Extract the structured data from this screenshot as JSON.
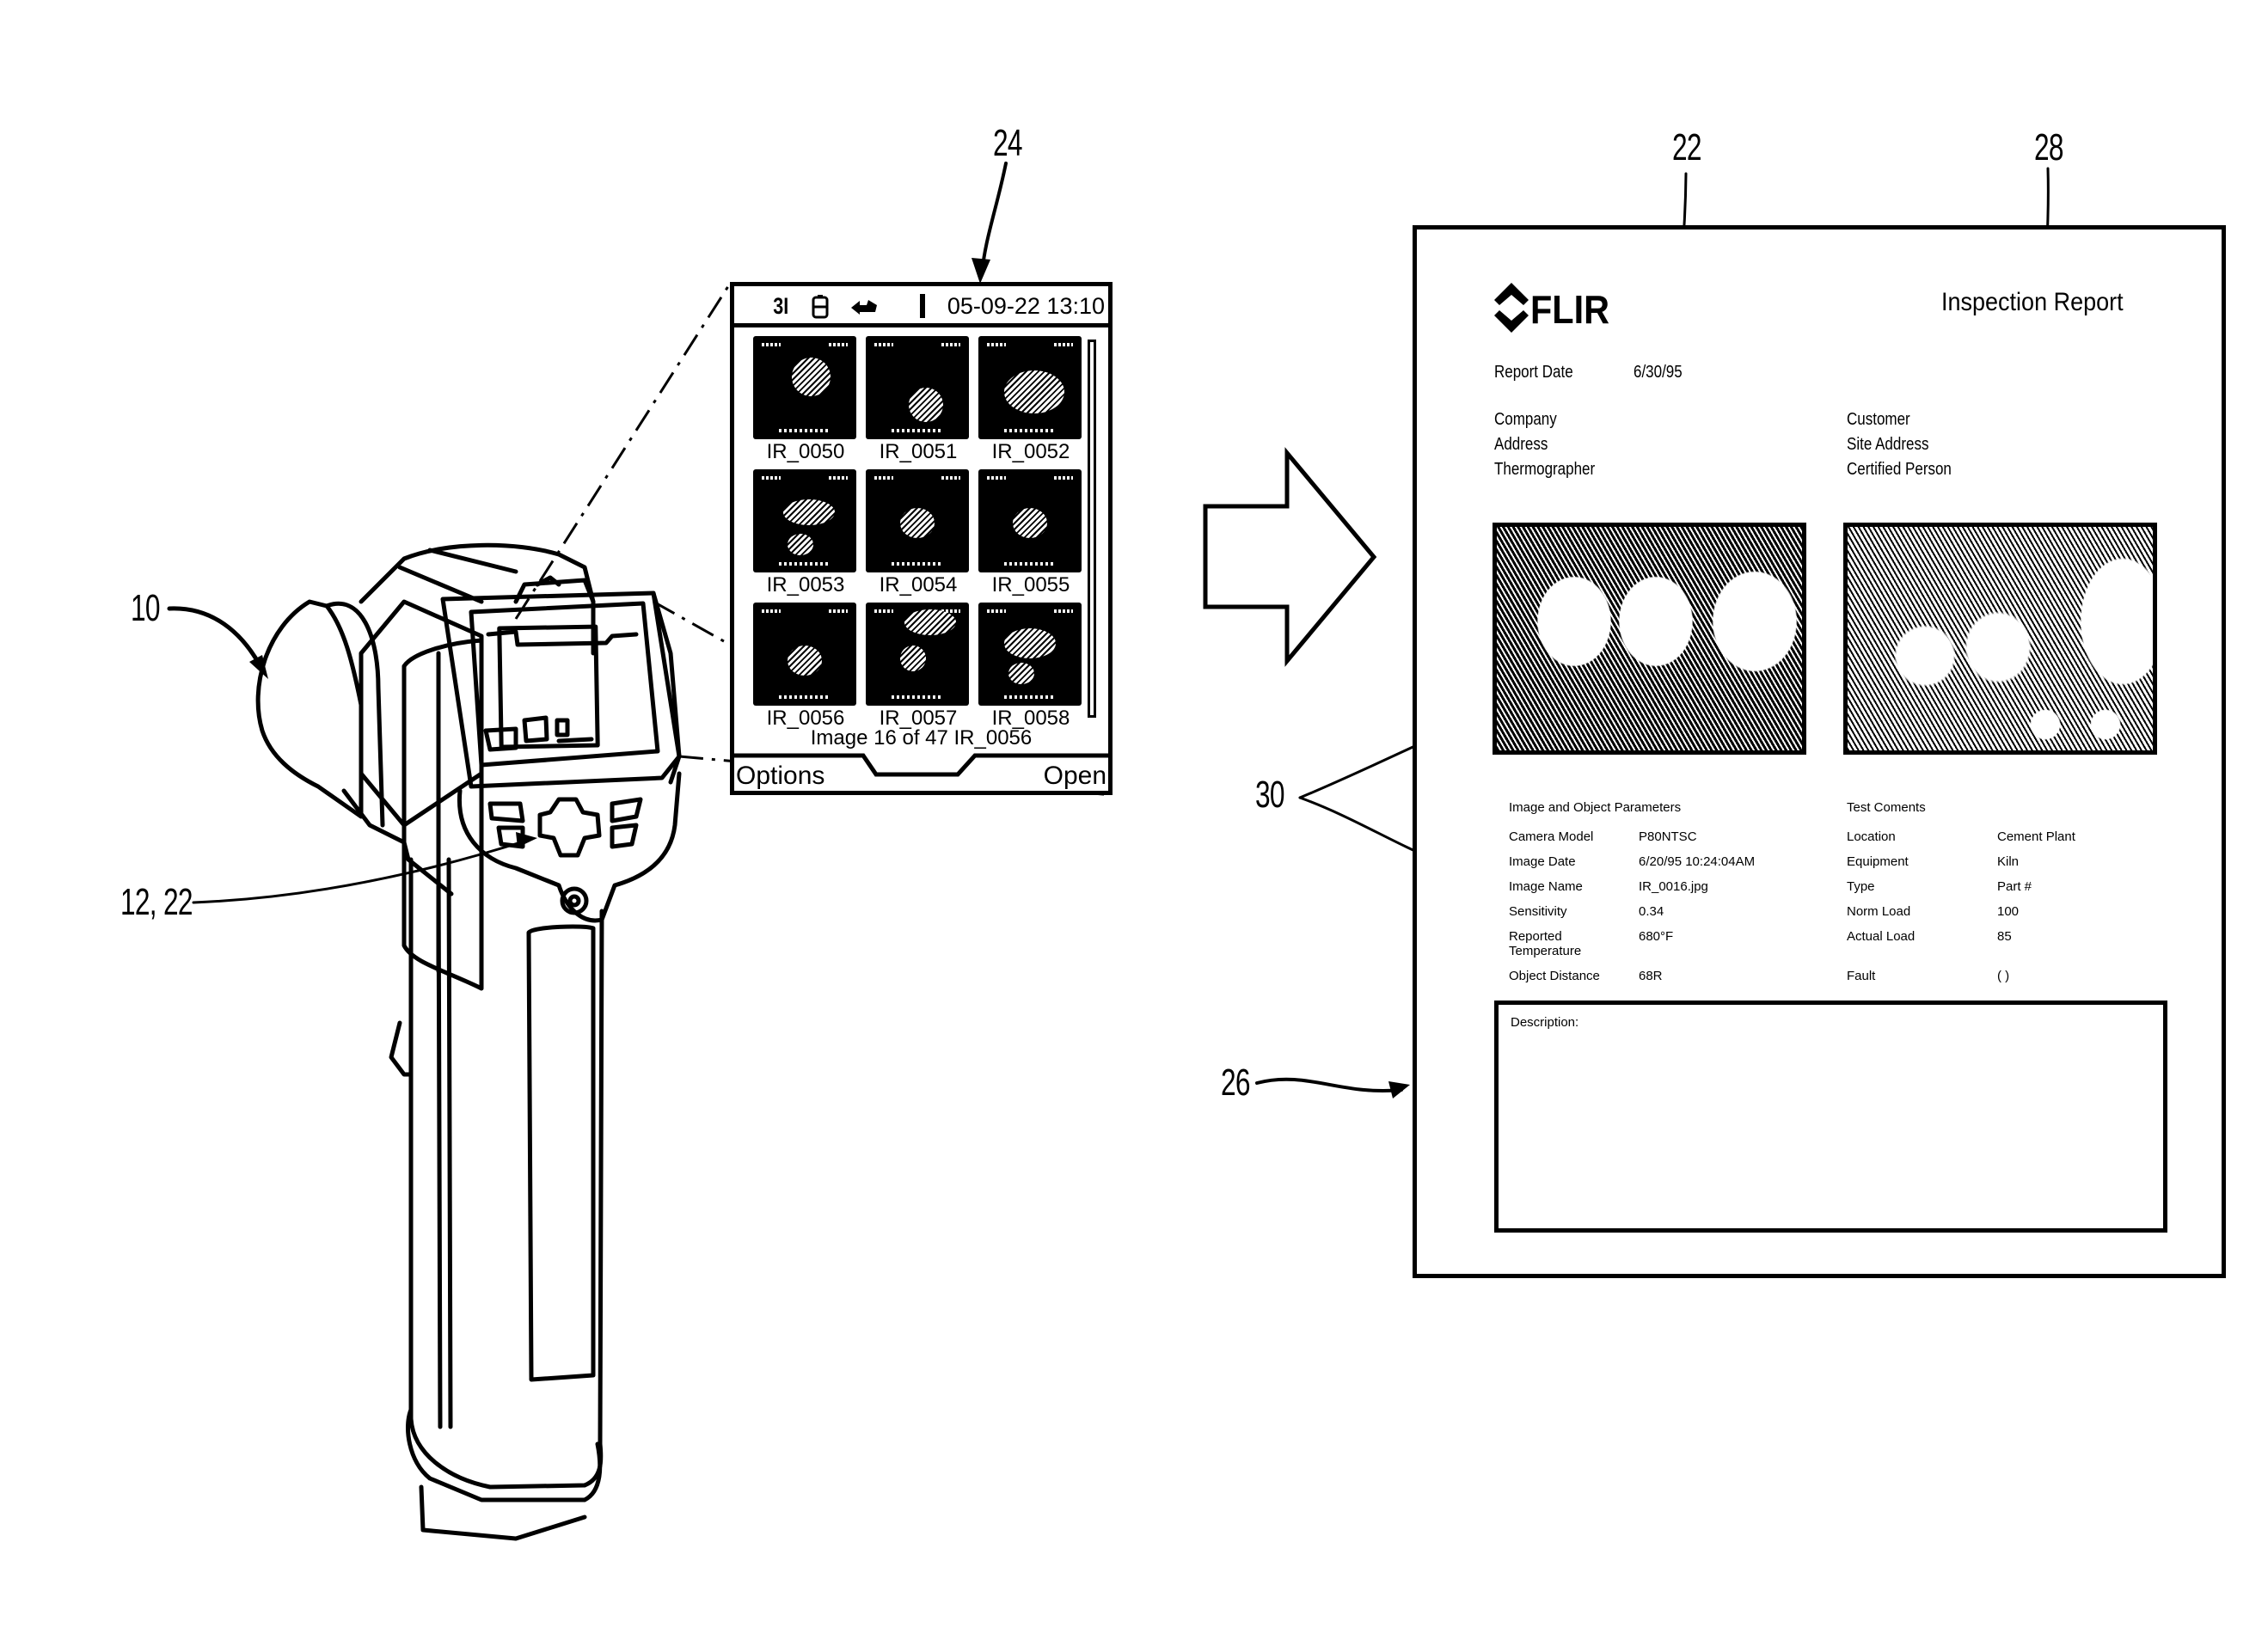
{
  "figure": {
    "reference_numerals": {
      "camera": "10",
      "camera_display": "12, 22",
      "screen_view": "24",
      "report": "26",
      "report_image_1": "22",
      "report_image_2": "28",
      "parameters": "30"
    }
  },
  "camera_screen": {
    "status_bar": {
      "icons": [
        {
          "name": "signal-icon",
          "glyph": "3I"
        },
        {
          "name": "battery-icon",
          "glyph": "battery"
        },
        {
          "name": "transfer-icon",
          "glyph": "arrow"
        },
        {
          "name": "divider-icon",
          "glyph": "I"
        }
      ],
      "datetime": "05-09-22 13:10"
    },
    "thumbnails": [
      {
        "label": "IR_0050"
      },
      {
        "label": "IR_0051"
      },
      {
        "label": "IR_0052"
      },
      {
        "label": "IR_0053"
      },
      {
        "label": "IR_0054"
      },
      {
        "label": "IR_0055"
      },
      {
        "label": "IR_0056"
      },
      {
        "label": "IR_0057"
      },
      {
        "label": "IR_0058"
      }
    ],
    "caption": "Image 16 of 47 IR_0056",
    "softkeys": {
      "left": "Options",
      "right": "Open"
    }
  },
  "report": {
    "logo": "FLIR",
    "title": "Inspection Report",
    "report_date_label": "Report Date",
    "report_date_value": "6/30/95",
    "left_fields": [
      "Company",
      "Address",
      "Thermographer"
    ],
    "right_fields": [
      "Customer",
      "Site Address",
      "Certified Person"
    ],
    "params_heading": "Image and Object Parameters",
    "comments_heading": "Test Coments",
    "params": [
      {
        "label": "Camera Model",
        "value": "P80NTSC"
      },
      {
        "label": "Image Date",
        "value": "6/20/95 10:24:04AM"
      },
      {
        "label": "Image Name",
        "value": "IR_0016.jpg"
      },
      {
        "label": "Sensitivity",
        "value": "0.34"
      },
      {
        "label": "Reported Temperature",
        "value": "680°F"
      },
      {
        "label": "Object Distance",
        "value": "68R"
      }
    ],
    "comments": [
      {
        "label": "Location",
        "value": "Cement Plant"
      },
      {
        "label": "Equipment",
        "value": "Kiln"
      },
      {
        "label": "Type",
        "value": "Part #"
      },
      {
        "label": "Norm Load",
        "value": "100"
      },
      {
        "label": "Actual Load",
        "value": "85"
      },
      {
        "label": "Fault",
        "value": "( )"
      }
    ],
    "description_label": "Description:"
  }
}
